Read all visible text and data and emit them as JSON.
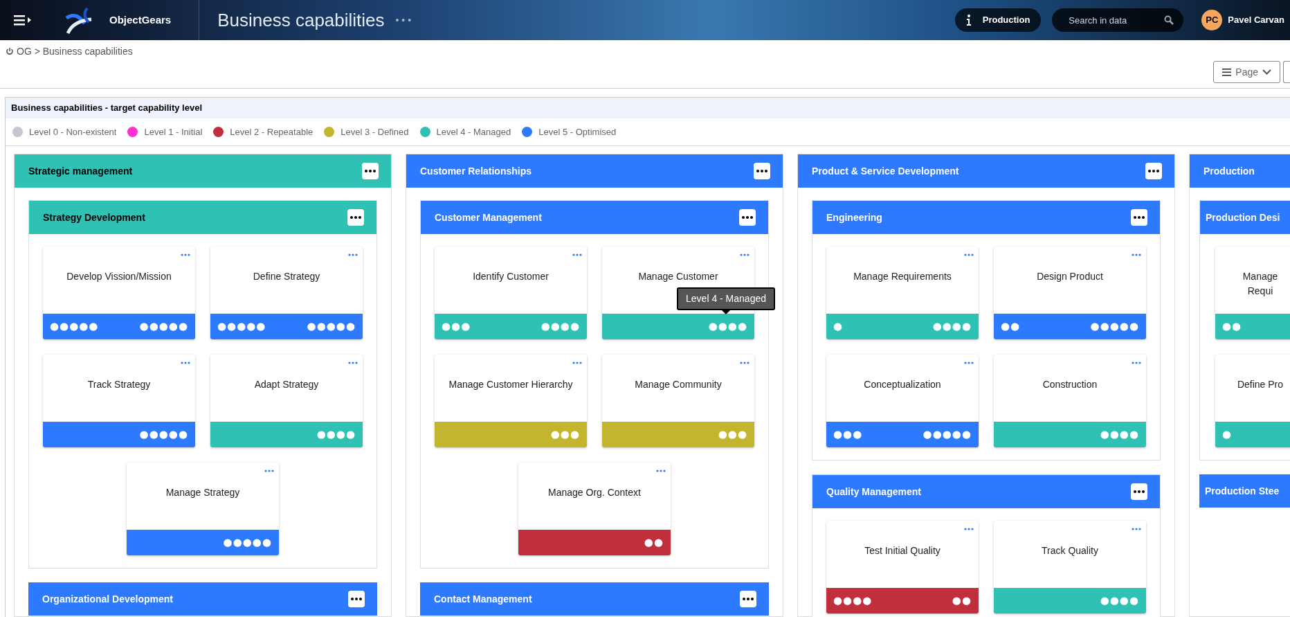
{
  "header": {
    "app_name": "ObjectGears",
    "title": "Business capabilities",
    "more": "• • •",
    "environment": "Production",
    "search": {
      "placeholder": "Search in data"
    },
    "user": {
      "initials": "PC",
      "name": "Pavel Carvan"
    }
  },
  "breadcrumb": "OG > Business capabilities",
  "toolbar": {
    "page_menu": "Page"
  },
  "panel": {
    "title": "Business capabilities - target capability level",
    "legend": [
      {
        "label": "Level 0 - Non-existent",
        "color": "#c3c7ce"
      },
      {
        "label": "Level 1 - Initial",
        "color": "#ff2fd6"
      },
      {
        "label": "Level 2 - Repeatable",
        "color": "#c22f3c"
      },
      {
        "label": "Level 3 - Defined",
        "color": "#c4b52e"
      },
      {
        "label": "Level 4 - Managed",
        "color": "#2fc1b4"
      },
      {
        "label": "Level 5 - Optimised",
        "color": "#2d7aff"
      }
    ],
    "columns": [
      {
        "name": "Strategic management",
        "color": "#2fc1b4",
        "groups": [
          {
            "name": "Strategy Development",
            "color": "#2fc1b4",
            "cards": [
              {
                "name": "Develop Vission/Mission",
                "color": "#2d7aff",
                "left_dots": "●●●●●",
                "right_dots": "●●●●●"
              },
              {
                "name": "Define Strategy",
                "color": "#2d7aff",
                "left_dots": "●●●●●",
                "right_dots": "●●●●●"
              },
              {
                "name": "Track Strategy",
                "color": "#2d7aff",
                "right_dots": "●●●●●"
              },
              {
                "name": "Adapt Strategy",
                "color": "#2fc1b4",
                "right_dots": "●●●●"
              },
              {
                "name": "Manage Strategy",
                "color": "#2d7aff",
                "right_dots": "●●●●●"
              }
            ]
          },
          {
            "name": "Organizational Development",
            "color": "#2d7aff"
          }
        ]
      },
      {
        "name": "Customer Relationships",
        "color": "#2d7aff",
        "groups": [
          {
            "name": "Customer Management",
            "color": "#2d7aff",
            "cards": [
              {
                "name": "Identify Customer",
                "color": "#2fc1b4",
                "left_dots": "●●●",
                "right_dots": "●●●●"
              },
              {
                "name": "Manage Customer",
                "color": "#2fc1b4",
                "right_dots": "●●●●",
                "tooltip": "Level 4 - Managed"
              },
              {
                "name": "Manage Customer Hierarchy",
                "color": "#c4b52e",
                "right_dots": "●●●"
              },
              {
                "name": "Manage Community",
                "color": "#c4b52e",
                "right_dots": "●●●"
              },
              {
                "name": "Manage Org. Context",
                "color": "#c22f3c",
                "right_dots": "●●"
              }
            ]
          },
          {
            "name": "Contact Management",
            "color": "#2d7aff"
          }
        ]
      },
      {
        "name": "Product & Service Development",
        "color": "#2d7aff",
        "groups": [
          {
            "name": "Engineering",
            "color": "#2d7aff",
            "cards": [
              {
                "name": "Manage Requirements",
                "color": "#2fc1b4",
                "left_dots": "●",
                "right_dots": "●●●●"
              },
              {
                "name": "Design Product",
                "color": "#2d7aff",
                "left_dots": "●●",
                "right_dots": "●●●●●"
              },
              {
                "name": "Conceptualization",
                "color": "#2d7aff",
                "left_dots": "●●●",
                "right_dots": "●●●●●"
              },
              {
                "name": "Construction",
                "color": "#2fc1b4",
                "right_dots": "●●●●"
              }
            ]
          },
          {
            "name": "Quality Management",
            "color": "#2d7aff",
            "cards": [
              {
                "name": "Test Initial Quality",
                "color": "#c22f3c",
                "left_dots": "●●●●",
                "right_dots": "●●"
              },
              {
                "name": "Track Quality",
                "color": "#2fc1b4",
                "right_dots": "●●●●"
              }
            ]
          }
        ]
      },
      {
        "name": "Production",
        "color": "#2d7aff",
        "groups": [
          {
            "name": "Production Desi",
            "color": "#2d7aff",
            "cards": [
              {
                "name": "Manage Requi",
                "color": "#2fc1b4",
                "left_dots": "●●"
              },
              {
                "name": "Define Pro",
                "color": "#2fc1b4",
                "left_dots": "●"
              }
            ]
          },
          {
            "name": "Production Stee",
            "color": "#2d7aff"
          }
        ]
      }
    ]
  }
}
